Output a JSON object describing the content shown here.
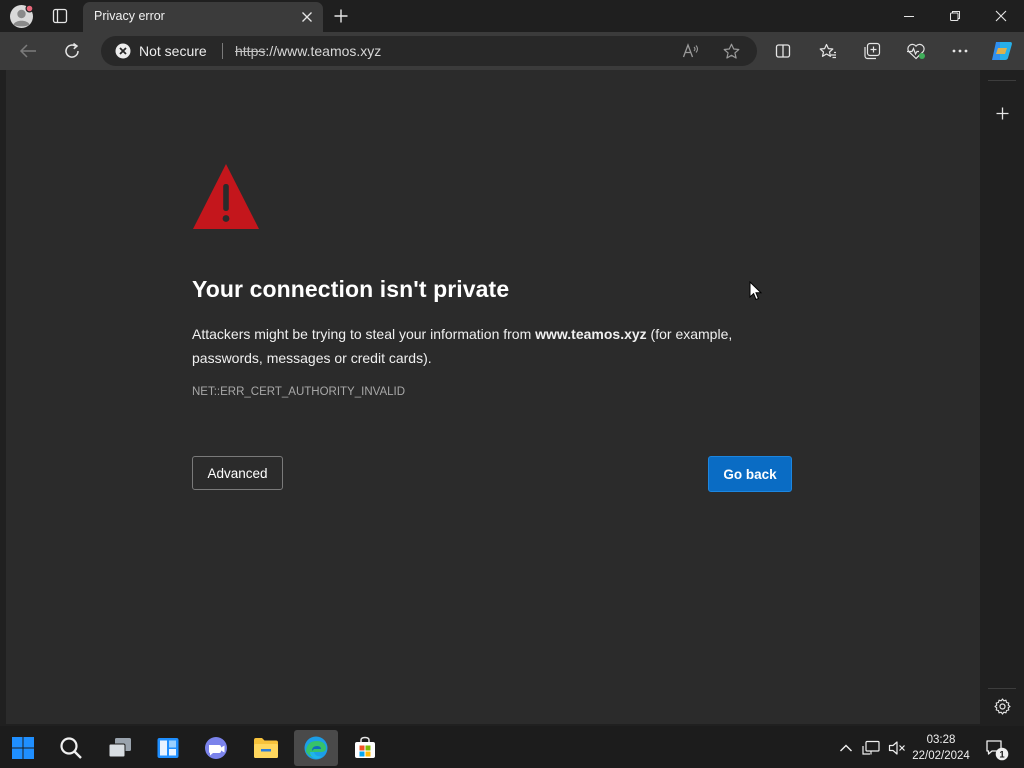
{
  "browser": {
    "tab_title": "Privacy error",
    "security_label": "Not secure",
    "url_scheme": "https",
    "url_rest": "://www.teamos.xyz"
  },
  "page": {
    "heading": "Your connection isn't private",
    "message_prefix": "Attackers might be trying to steal your information from ",
    "message_domain": "www.teamos.xyz",
    "message_suffix": " (for example, passwords, messages or credit cards).",
    "error_code": "NET::ERR_CERT_AUTHORITY_INVALID",
    "advanced_label": "Advanced",
    "go_back_label": "Go back"
  },
  "taskbar": {
    "time": "03:28",
    "date": "22/02/2024",
    "notification_count": "1"
  },
  "icons": {
    "warning": "warning-triangle-icon",
    "security": "not-secure-icon"
  },
  "colors": {
    "warning_red": "#c4161c",
    "go_back_blue": "#0a6cc4",
    "page_bg": "#2b2b2b"
  }
}
